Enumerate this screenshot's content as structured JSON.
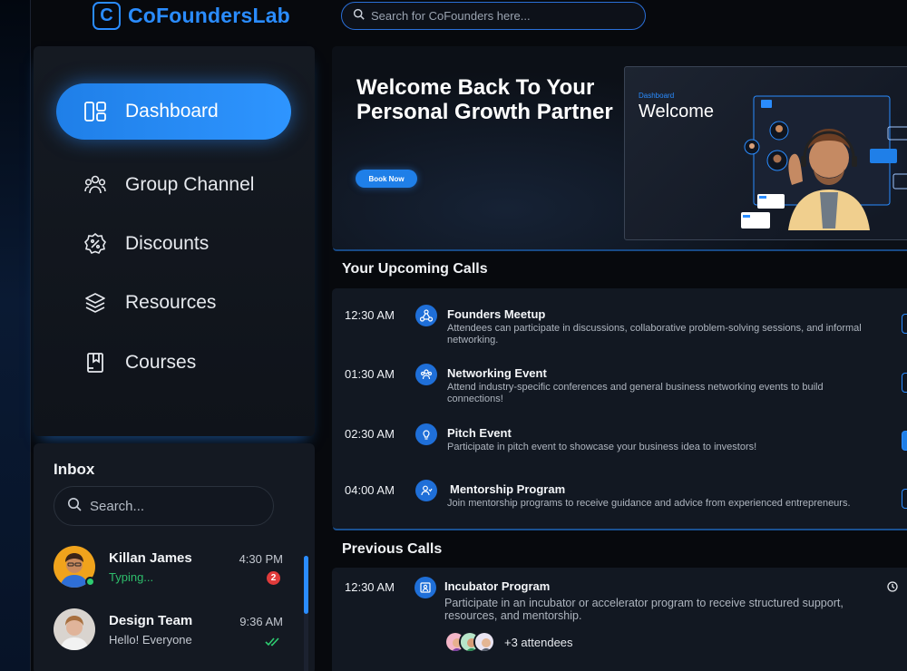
{
  "header": {
    "logo_mark": "C",
    "logo_text": "CoFoundersLab",
    "search_placeholder": "Search for CoFounders here..."
  },
  "sidebar": {
    "items": [
      {
        "label": "Dashboard",
        "icon": "dashboard-icon",
        "active": true
      },
      {
        "label": "Group Channel",
        "icon": "group-icon",
        "active": false
      },
      {
        "label": "Discounts",
        "icon": "discount-icon",
        "active": false
      },
      {
        "label": "Resources",
        "icon": "layers-icon",
        "active": false
      },
      {
        "label": "Courses",
        "icon": "book-icon",
        "active": false
      }
    ]
  },
  "inbox": {
    "title": "Inbox",
    "search_placeholder": "Search...",
    "messages": [
      {
        "name": "Killan James",
        "preview": "Typing...",
        "time": "4:30 PM",
        "unread": "2",
        "online": true
      },
      {
        "name": "Design Team",
        "preview": "Hello! Everyone",
        "time": "9:36 AM",
        "read": true
      }
    ]
  },
  "hero": {
    "title": "Welcome Back To Your Personal Growth Partner",
    "button": "Book Now",
    "card_label": "Dashboard",
    "card_title": "Welcome"
  },
  "upcoming": {
    "title": "Your Upcoming Calls",
    "calls": [
      {
        "time": "12:30 AM",
        "title": "Founders Meetup",
        "desc": "Attendees can participate in discussions, collaborative problem-solving sessions, and informal networking.",
        "icon": "network-icon"
      },
      {
        "time": "01:30 AM",
        "title": "Networking Event",
        "desc": "Attend industry-specific conferences and general business networking events to build connections!",
        "icon": "group-icon"
      },
      {
        "time": "02:30 AM",
        "title": "Pitch Event",
        "desc": "Participate in pitch event to showcase your business idea to investors!",
        "icon": "lightbulb-icon"
      },
      {
        "time": "04:00 AM",
        "title": "Mentorship Program",
        "desc": "Join mentorship programs to receive guidance and advice from experienced entrepreneurs.",
        "icon": "mentor-icon"
      }
    ]
  },
  "previous": {
    "title": "Previous Calls",
    "calls": [
      {
        "time": "12:30 AM",
        "title": "Incubator Program",
        "desc": "Participate in an incubator or accelerator program to receive structured support, resources, and mentorship.",
        "attendees": "+3 attendees",
        "icon": "incubator-icon"
      }
    ]
  },
  "colors": {
    "accent": "#2a8cff",
    "background": "#07090d",
    "panel": "#141922",
    "online": "#2ecc71",
    "badge": "#e03b3b"
  }
}
